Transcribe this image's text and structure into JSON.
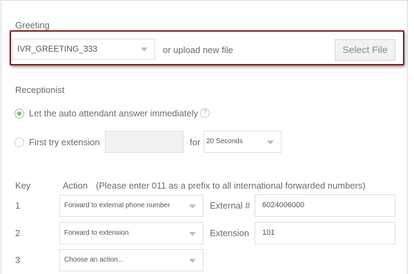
{
  "greeting": {
    "label": "Greeting",
    "selected_greeting": "IVR_GREETING_333",
    "or_upload_text": "or upload new file",
    "select_file_label": "Select File"
  },
  "receptionist": {
    "label": "Receptionist",
    "option_auto": "Let the auto attendant answer immediately",
    "option_auto_checked": true,
    "option_first_try": "First try extension",
    "option_first_try_checked": false,
    "extension_value": "",
    "for_label": "for",
    "timeout_value": "20 Seconds",
    "help_icon": "?"
  },
  "keys": {
    "key_header": "Key",
    "action_header": "Action",
    "action_hint": "(Please enter 011 as a prefix to all international forwarded numbers)",
    "rows": [
      {
        "key": "1",
        "action": "Forward to external phone number",
        "field_label": "External #",
        "field_value": "6024006000"
      },
      {
        "key": "2",
        "action": "Forward to extension",
        "field_label": "Extension",
        "field_value": "101"
      },
      {
        "key": "3",
        "action": "Choose an action...",
        "field_label": "",
        "field_value": ""
      }
    ]
  },
  "colors": {
    "highlight_border": "#7a1f1f",
    "radio_checked": "#6fbf62"
  }
}
